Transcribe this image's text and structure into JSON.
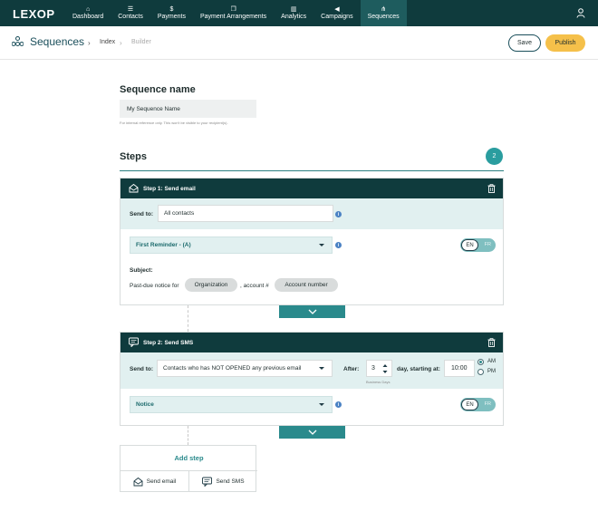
{
  "nav": {
    "logo": "LEXOP",
    "items": [
      {
        "label": "Dashboard",
        "icon": "home-icon"
      },
      {
        "label": "Contacts",
        "icon": "contacts-icon"
      },
      {
        "label": "Payments",
        "icon": "dollar-icon"
      },
      {
        "label": "Payment Arrangements",
        "icon": "stack-icon"
      },
      {
        "label": "Analytics",
        "icon": "chart-icon"
      },
      {
        "label": "Campaigns",
        "icon": "megaphone-icon"
      },
      {
        "label": "Sequences",
        "icon": "sequence-icon",
        "active": true
      }
    ],
    "user_icon": "user-icon"
  },
  "header": {
    "title": "Sequences",
    "breadcrumb": [
      "Index",
      "Builder"
    ],
    "save_label": "Save",
    "publish_label": "Publish"
  },
  "sequence": {
    "heading": "Sequence name",
    "value": "My Sequence Name",
    "hint": "For internal reference only. This won't be visible to your recipient(s)."
  },
  "steps_section": {
    "heading": "Steps",
    "count": "2"
  },
  "step1": {
    "title": "Step 1: Send email",
    "send_to_label": "Send to:",
    "send_to_value": "All contacts",
    "template": "First Reminder - (A)",
    "lang_en": "EN",
    "lang_fr": "FR",
    "subject_label": "Subject:",
    "subject_prefix": "Past-due notice for",
    "chip_org": "Organization",
    "subject_mid": ", account #",
    "chip_account": "Account number"
  },
  "step2": {
    "title": "Step 2: Send SMS",
    "send_to_label": "Send to:",
    "send_to_value": "Contacts who has NOT OPENED any previous email",
    "after_label": "After:",
    "after_value": "3",
    "after_unit": "day, starting at:",
    "business_days": "Business Days",
    "time": "10:00",
    "am": "AM",
    "pm": "PM",
    "template": "Notice",
    "lang_en": "EN",
    "lang_fr": "FR"
  },
  "add_step": {
    "title": "Add step",
    "email": "Send email",
    "sms": "Send SMS"
  },
  "colors": {
    "nav_bg": "#0f3b3d",
    "accent": "#2a8a8c",
    "publish": "#f5c04a"
  }
}
